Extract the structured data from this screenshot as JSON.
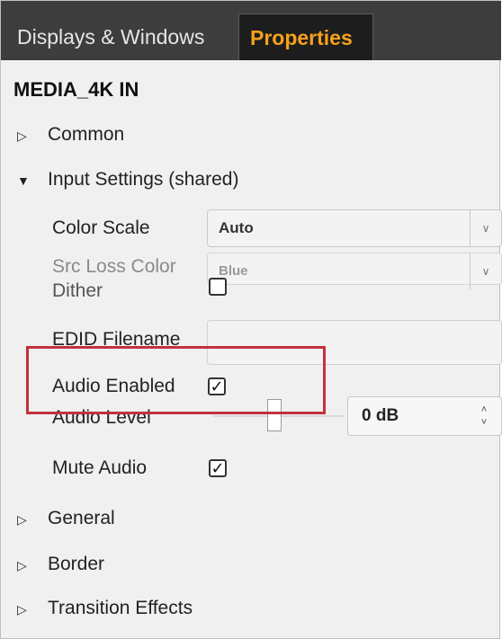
{
  "tabs": [
    {
      "label": "Displays & Windows",
      "active": false
    },
    {
      "label": "Properties",
      "active": true
    }
  ],
  "title": "MEDIA_4K IN",
  "sections": {
    "common": "Common",
    "input_settings": "Input Settings (shared)",
    "general": "General",
    "border": "Border",
    "transition_effects": "Transition Effects"
  },
  "input_settings": {
    "color_scale": {
      "label": "Color Scale",
      "value": "Auto"
    },
    "src_loss_color": {
      "label": "Src Loss Color",
      "value": "Blue"
    },
    "dither": {
      "label": "Dither",
      "checked": false
    },
    "edid_filename": {
      "label": "EDID Filename",
      "value": ""
    },
    "audio_enabled": {
      "label": "Audio Enabled",
      "checked": true
    },
    "audio_level": {
      "label": "Audio Level",
      "value": "0 dB"
    },
    "mute_audio": {
      "label": "Mute Audio",
      "checked": true
    }
  },
  "glyphs": {
    "collapsed": "▷",
    "expanded": "▼",
    "dropdown": "∨",
    "check": "✓",
    "spin_up": "˄",
    "spin_down": "˅"
  },
  "colors": {
    "active_tab_text": "#f6a11a",
    "highlight_box": "#c0323f"
  }
}
